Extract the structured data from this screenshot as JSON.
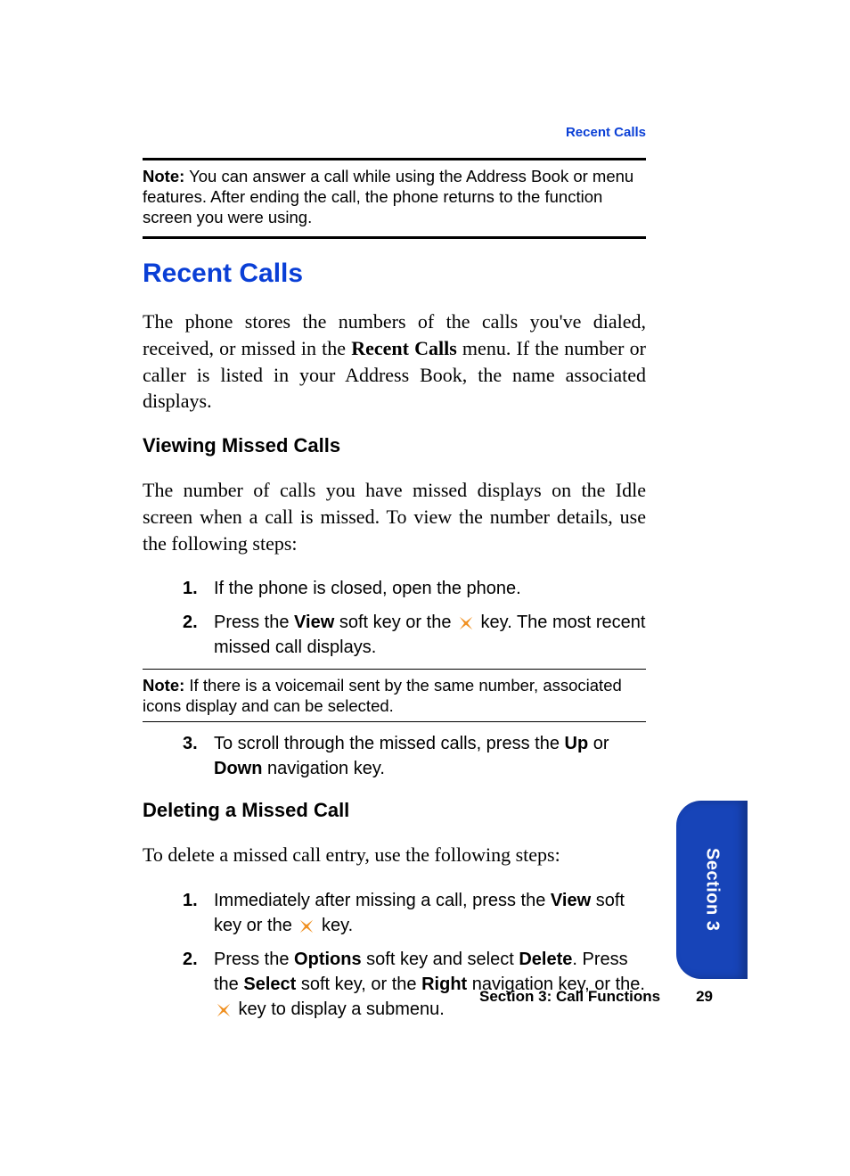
{
  "header": {
    "breadcrumb": "Recent Calls"
  },
  "note1": {
    "label": "Note:",
    "text": " You can answer a call while using the Address Book or menu features. After ending the call, the phone returns to the function screen you were using."
  },
  "section": {
    "title": "Recent Calls",
    "intro_a": "The phone stores the numbers of the calls you've dialed, received, or missed in the ",
    "intro_b": "Recent Calls",
    "intro_c": " menu. If the number or caller is listed in your Address Book, the name associated displays."
  },
  "viewing": {
    "heading": "Viewing Missed Calls",
    "intro": "The number of calls you have missed displays on the Idle screen when a call is missed. To view the number details, use the following steps:",
    "steps12": {
      "s1": "If the phone is closed, open the phone.",
      "s2a": "Press the ",
      "s2b": "View",
      "s2c": " soft key or the ",
      "s2d": " key. The most recent missed call displays."
    },
    "note": {
      "label": "Note:",
      "text": " If there is a voicemail sent by the same number, associated icons display and can be selected."
    },
    "steps3": {
      "s3a": "To scroll through the missed calls, press the ",
      "s3b": "Up",
      "s3c": " or ",
      "s3d": "Down",
      "s3e": " navigation key."
    }
  },
  "deleting": {
    "heading": "Deleting a Missed Call",
    "intro": "To delete a missed call entry, use the following steps:",
    "steps": {
      "s1a": "Immediately after missing a call, press the ",
      "s1b": "View",
      "s1c": " soft key or the ",
      "s1d": " key.",
      "s2a": "Press the ",
      "s2b": "Options",
      "s2c": " soft key and select ",
      "s2d": "Delete",
      "s2e": ". Press the ",
      "s2f": "Select",
      "s2g": " soft key, or the ",
      "s2h": "Right",
      "s2i": " navigation key, or the.",
      "s2j": " key to display a submenu."
    }
  },
  "footer": {
    "section": "Section 3: Call Functions",
    "page": "29"
  },
  "sidetab": {
    "label": "Section 3"
  }
}
